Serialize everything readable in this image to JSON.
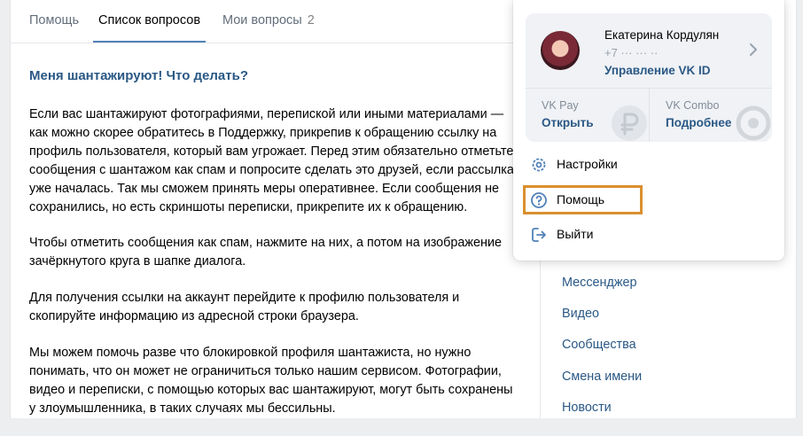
{
  "tabs": [
    {
      "label": "Помощь"
    },
    {
      "label": "Список вопросов"
    },
    {
      "label": "Мои вопросы",
      "count": "2"
    }
  ],
  "article": {
    "title": "Меня шантажируют! Что делать?",
    "paragraphs": [
      "Если вас шантажируют фотографиями, перепиской или иными материалами — как можно скорее обратитесь в Поддержку, прикрепив к обращению ссылку на профиль пользователя, который вам угрожает. Перед этим обязательно отметьте сообщения с шантажом как спам и попросите сделать это друзей, если рассылка уже началась. Так мы сможем принять меры оперативнее. Если сообщения не сохранились, но есть скриншоты переписки, прикрепите их к обращению.",
      "Чтобы отметить сообщения как спам, нажмите на них, а потом на изображение зачёркнутого круга в шапке диалога.",
      "Для получения ссылки на аккаунт перейдите к профилю пользователя и скопируйте информацию из адресной строки браузера.",
      "Мы можем помочь разве что блокировкой профиля шантажиста, но нужно понимать, что он может не ограничиться только нашим сервисом. Фотографии, видео и переписки, с помощью которых вас шантажируют, могут быть сохранены у злоумышленника, в таких случаях мы бессильны."
    ]
  },
  "sidebar": {
    "items": [
      {
        "label": "Мессенджер"
      },
      {
        "label": "Видео"
      },
      {
        "label": "Сообщества"
      },
      {
        "label": "Смена имени"
      },
      {
        "label": "Новости"
      }
    ]
  },
  "dropdown": {
    "profile": {
      "name": "Екатерина Кордулян",
      "phone": "+7 ··· ··· ··",
      "manage_link": "Управление VK ID"
    },
    "services": [
      {
        "name": "VK Pay",
        "action": "Открыть",
        "icon": "ruble-icon"
      },
      {
        "name": "VK Combo",
        "action": "Подробнее",
        "icon": "combo-icon"
      }
    ],
    "menu": [
      {
        "label": "Настройки",
        "icon": "gear-icon"
      },
      {
        "label": "Помощь",
        "icon": "question-icon"
      },
      {
        "label": "Выйти",
        "icon": "logout-icon"
      }
    ]
  },
  "colors": {
    "accent": "#2a5885",
    "tab_underline": "#5181b8",
    "highlight": "#d9902f",
    "page_bg": "#edeef0"
  }
}
